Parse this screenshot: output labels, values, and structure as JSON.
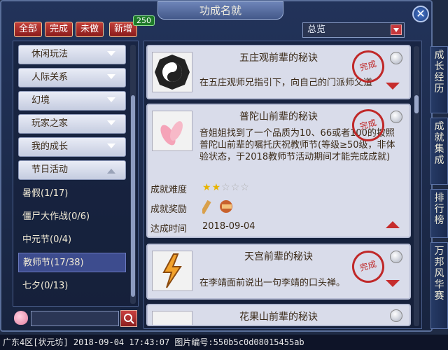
{
  "window": {
    "title": "功成名就",
    "close_label": "✕"
  },
  "tabs": [
    {
      "label": "全部"
    },
    {
      "label": "完成"
    },
    {
      "label": "未做"
    },
    {
      "label": "新增"
    }
  ],
  "new_count": "250",
  "filter": {
    "selected": "总览"
  },
  "categories": [
    {
      "label": "休闲玩法"
    },
    {
      "label": "人际关系"
    },
    {
      "label": "幻境"
    },
    {
      "label": "玩家之家"
    },
    {
      "label": "我的成长"
    },
    {
      "label": "节日活动"
    }
  ],
  "subcategories": [
    {
      "label": "暑假(1/17)"
    },
    {
      "label": "僵尸大作战(0/6)"
    },
    {
      "label": "中元节(0/4)"
    },
    {
      "label": "教师节(17/38)"
    },
    {
      "label": "七夕(0/13)"
    }
  ],
  "search": {
    "placeholder": ""
  },
  "achievements": [
    {
      "name": "五庄观前辈的秘诀",
      "desc": "在五庄观师兄指引下，向自己的门派师父道",
      "stamp": "完成"
    },
    {
      "name": "普陀山前辈的秘诀",
      "desc": "音姐姐找到了一个品质为10、66或者100的按照普陀山前辈的嘱托庆祝教师节(等级≥50级，非体验状态，于2018教师节活动期间才能完成成就)",
      "stamp": "完成",
      "difficulty_label": "成就难度",
      "difficulty_stars": 2,
      "difficulty_max": 5,
      "reward_label": "成就奖励",
      "time_label": "达成时间",
      "time_value": "2018-09-04"
    },
    {
      "name": "天宫前辈的秘诀",
      "desc": "在李靖面前说出一句李靖的口头禅。",
      "stamp": "完成"
    },
    {
      "name": "花果山前辈的秘诀",
      "desc": "",
      "stamp": ""
    }
  ],
  "side_tabs": [
    {
      "label": "成长经历"
    },
    {
      "label": "成就集成"
    },
    {
      "label": "排行榜"
    },
    {
      "label": "万邦风华赛"
    }
  ],
  "status_bar": "广东4区[状元坊] 2018-09-04 17:43:07 图片编号:550b5c0d08015455ab",
  "colors": {
    "accent_red": "#c62d2d",
    "panel_bg": "#d9dcea",
    "frame": "#22335a"
  }
}
